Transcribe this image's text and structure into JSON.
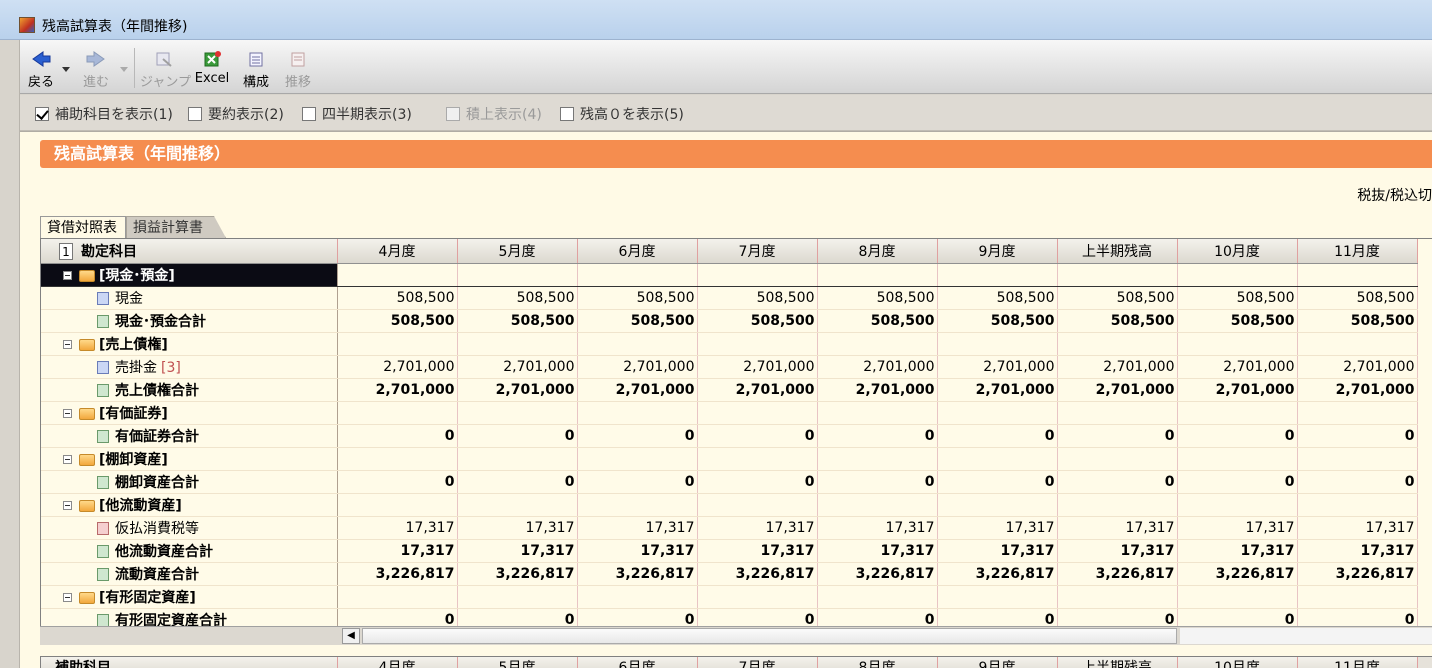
{
  "window": {
    "title": "残高試算表（年間推移)"
  },
  "toolbar": {
    "back": "戻る",
    "forward": "進む",
    "jump": "ジャンプ",
    "excel": "Excel",
    "structure": "構成",
    "transition": "推移"
  },
  "options": [
    {
      "label": "補助科目を表示(1)",
      "checked": true,
      "disabled": false
    },
    {
      "label": "要約表示(2)",
      "checked": false,
      "disabled": false
    },
    {
      "label": "四半期表示(3)",
      "checked": false,
      "disabled": false
    },
    {
      "label": "積上表示(4)",
      "checked": false,
      "disabled": true
    },
    {
      "label": "残高０を表示(5)",
      "checked": false,
      "disabled": false
    }
  ],
  "panel": {
    "header": "残高試算表（年間推移）",
    "tax_toggle": "税抜/税込切"
  },
  "tabs": {
    "balance_sheet": "貸借対照表",
    "income_statement": "損益計算書"
  },
  "grid": {
    "row_number": "1",
    "account_header": "勘定科目",
    "columns": [
      "4月度",
      "5月度",
      "6月度",
      "7月度",
      "8月度",
      "9月度",
      "上半期残高",
      "10月度",
      "11月度"
    ],
    "rows": [
      {
        "type": "group",
        "label": "[現金･預金]",
        "selected": true
      },
      {
        "type": "item",
        "label": "現金",
        "values": [
          "508,500",
          "508,500",
          "508,500",
          "508,500",
          "508,500",
          "508,500",
          "508,500",
          "508,500",
          "508,500"
        ]
      },
      {
        "type": "total",
        "label": "現金･預金合計",
        "values": [
          "508,500",
          "508,500",
          "508,500",
          "508,500",
          "508,500",
          "508,500",
          "508,500",
          "508,500",
          "508,500"
        ]
      },
      {
        "type": "group",
        "label": "[売上債権]"
      },
      {
        "type": "item",
        "label": "売掛金",
        "sub": "[3]",
        "values": [
          "2,701,000",
          "2,701,000",
          "2,701,000",
          "2,701,000",
          "2,701,000",
          "2,701,000",
          "2,701,000",
          "2,701,000",
          "2,701,000"
        ]
      },
      {
        "type": "total",
        "label": "売上債権合計",
        "values": [
          "2,701,000",
          "2,701,000",
          "2,701,000",
          "2,701,000",
          "2,701,000",
          "2,701,000",
          "2,701,000",
          "2,701,000",
          "2,701,000"
        ]
      },
      {
        "type": "group",
        "label": "[有価証券]"
      },
      {
        "type": "total",
        "label": "有価証券合計",
        "values": [
          "0",
          "0",
          "0",
          "0",
          "0",
          "0",
          "0",
          "0",
          "0"
        ]
      },
      {
        "type": "group",
        "label": "[棚卸資産]"
      },
      {
        "type": "total",
        "label": "棚卸資産合計",
        "values": [
          "0",
          "0",
          "0",
          "0",
          "0",
          "0",
          "0",
          "0",
          "0"
        ]
      },
      {
        "type": "group",
        "label": "[他流動資産]"
      },
      {
        "type": "tax",
        "label": "仮払消費税等",
        "values": [
          "17,317",
          "17,317",
          "17,317",
          "17,317",
          "17,317",
          "17,317",
          "17,317",
          "17,317",
          "17,317"
        ]
      },
      {
        "type": "total",
        "label": "他流動資産合計",
        "values": [
          "17,317",
          "17,317",
          "17,317",
          "17,317",
          "17,317",
          "17,317",
          "17,317",
          "17,317",
          "17,317"
        ]
      },
      {
        "type": "total",
        "label": "流動資産合計",
        "values": [
          "3,226,817",
          "3,226,817",
          "3,226,817",
          "3,226,817",
          "3,226,817",
          "3,226,817",
          "3,226,817",
          "3,226,817",
          "3,226,817"
        ]
      },
      {
        "type": "group",
        "label": "[有形固定資産]"
      },
      {
        "type": "total",
        "label": "有形固定資産合計",
        "values": [
          "0",
          "0",
          "0",
          "0",
          "0",
          "0",
          "0",
          "0",
          "0"
        ]
      }
    ]
  },
  "bottom_grid": {
    "account_header": "補助科目",
    "columns": [
      "4月度",
      "5月度",
      "6月度",
      "7月度",
      "8月度",
      "9月度",
      "上半期残高",
      "10月度",
      "11月度"
    ]
  },
  "colors": {
    "banner": "#f58d4f",
    "grid_bg": "#fffbe8",
    "selected": "#0b0b14"
  }
}
